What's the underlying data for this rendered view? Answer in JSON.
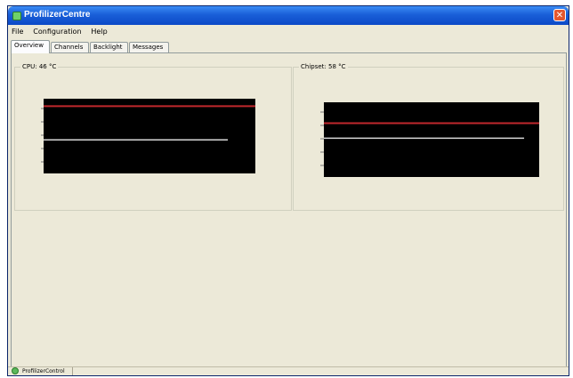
{
  "window": {
    "title": "ProfilizerCentre"
  },
  "menu": [
    "File",
    "Configuration",
    "Help"
  ],
  "tabs": [
    {
      "label": "Overview",
      "active": true
    },
    {
      "label": "Channels",
      "active": false
    },
    {
      "label": "Backlight",
      "active": false
    },
    {
      "label": "Messages",
      "active": false
    }
  ],
  "overview": {
    "cpu": {
      "label": "CPU: 46 °C",
      "limit_color": "#c0282d",
      "trace_color": "#d8d8d8",
      "limit_level": 0.9,
      "trace_level": 0.45,
      "trace_end": 0.87
    },
    "chipset": {
      "label": "Chipset: 58 °C",
      "limit_color": "#c0282d",
      "trace_color": "#d8d8d8",
      "limit_level": 0.72,
      "trace_level": 0.52,
      "trace_end": 0.93
    }
  },
  "statusbar": {
    "text": "ProfilizerControl"
  },
  "colors": {
    "title_bar": "#0b49c7",
    "chart_bg": "#000000",
    "window_bg": "#ece9d8"
  }
}
